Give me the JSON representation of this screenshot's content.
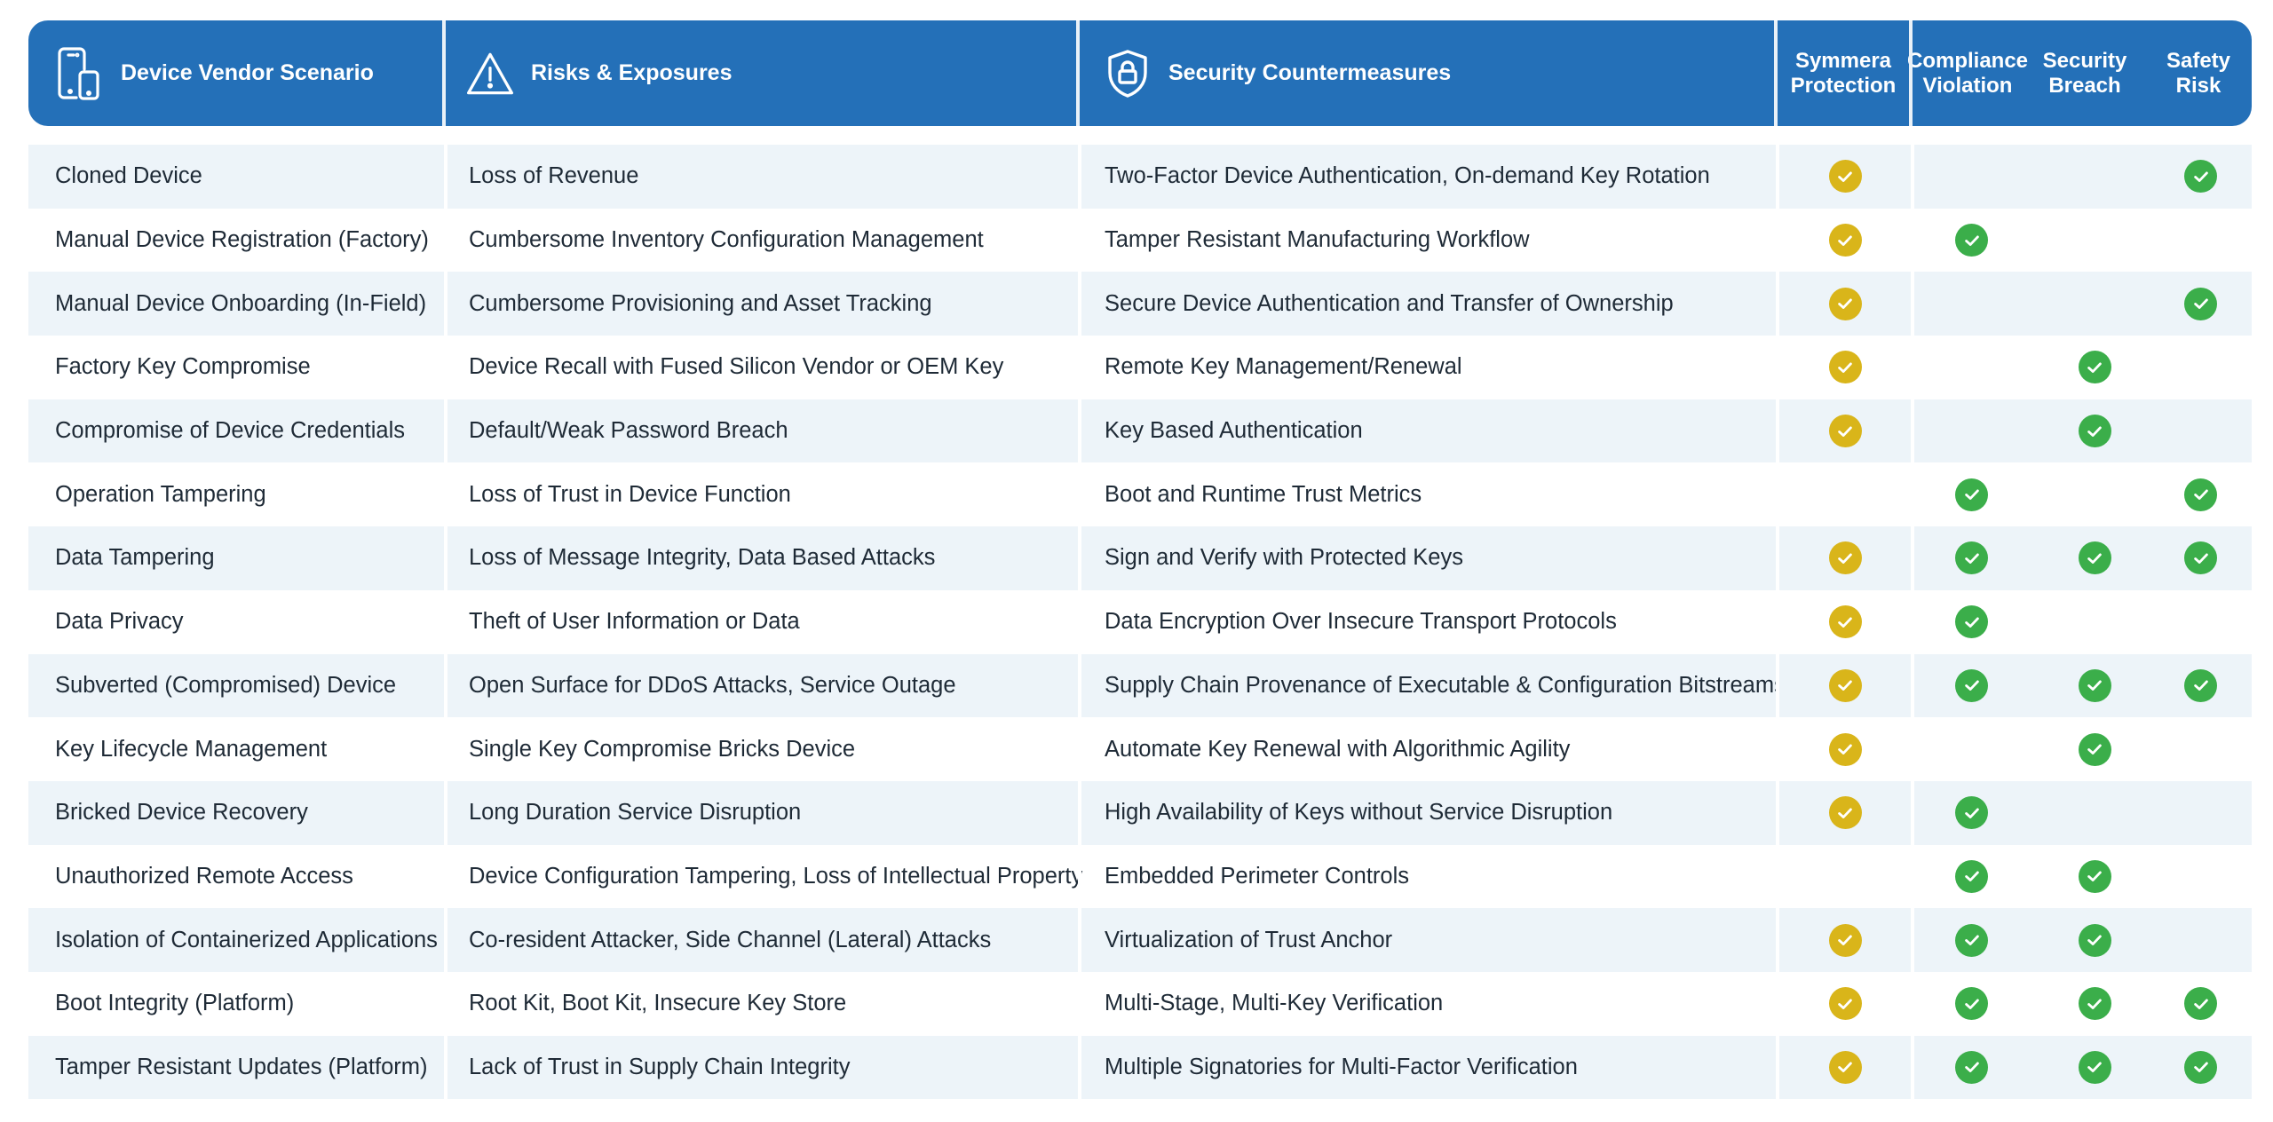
{
  "colors": {
    "header_bg": "#2470b8",
    "row_stripe": "#edf4f9",
    "symmera_check": "#d9b51a",
    "risk_check": "#3bae4a",
    "text": "#1e2a36"
  },
  "header": {
    "scenario": {
      "label": "Device Vendor Scenario",
      "icon": "mobile-devices-icon"
    },
    "risks": {
      "label": "Risks & Exposures",
      "icon": "warning-triangle-icon"
    },
    "countermeasures": {
      "label": "Security Countermeasures",
      "icon": "shield-lock-icon"
    },
    "symmera": {
      "line1": "Symmera",
      "line2": "Protection"
    },
    "compliance": {
      "line1": "Compliance",
      "line2": "Violation"
    },
    "breach": {
      "line1": "Security",
      "line2": "Breach"
    },
    "safety": {
      "line1": "Safety",
      "line2": "Risk"
    }
  },
  "rows": [
    {
      "scenario": "Cloned Device",
      "risk": "Loss of Revenue",
      "countermeasure": "Two-Factor Device Authentication, On-demand Key Rotation",
      "symmera": true,
      "compliance": false,
      "breach": false,
      "safety": true
    },
    {
      "scenario": "Manual Device Registration (Factory)",
      "risk": "Cumbersome Inventory Configuration Management",
      "countermeasure": "Tamper Resistant Manufacturing Workflow",
      "symmera": true,
      "compliance": true,
      "breach": false,
      "safety": false
    },
    {
      "scenario": "Manual Device Onboarding (In-Field)",
      "risk": "Cumbersome Provisioning and Asset Tracking",
      "countermeasure": "Secure Device Authentication and Transfer of Ownership",
      "symmera": true,
      "compliance": false,
      "breach": false,
      "safety": true
    },
    {
      "scenario": "Factory Key Compromise",
      "risk": "Device Recall with Fused Silicon Vendor or OEM Key",
      "countermeasure": "Remote Key Management/Renewal",
      "symmera": true,
      "compliance": false,
      "breach": true,
      "safety": false
    },
    {
      "scenario": "Compromise of Device Credentials",
      "risk": "Default/Weak Password Breach",
      "countermeasure": "Key Based Authentication",
      "symmera": true,
      "compliance": false,
      "breach": true,
      "safety": false
    },
    {
      "scenario": "Operation Tampering",
      "risk": "Loss of Trust in Device Function",
      "countermeasure": "Boot and Runtime Trust Metrics",
      "symmera": false,
      "compliance": true,
      "breach": false,
      "safety": true
    },
    {
      "scenario": "Data Tampering",
      "risk": "Loss of Message Integrity, Data Based Attacks",
      "countermeasure": "Sign and Verify with Protected Keys",
      "symmera": true,
      "compliance": true,
      "breach": true,
      "safety": true
    },
    {
      "scenario": "Data Privacy",
      "risk": "Theft of User Information or Data",
      "countermeasure": "Data Encryption Over Insecure Transport Protocols",
      "symmera": true,
      "compliance": true,
      "breach": false,
      "safety": false
    },
    {
      "scenario": "Subverted (Compromised) Device",
      "risk": "Open Surface for DDoS Attacks, Service Outage",
      "countermeasure": "Supply Chain Provenance of Executable & Configuration Bitstreams",
      "symmera": true,
      "compliance": true,
      "breach": true,
      "safety": true
    },
    {
      "scenario": "Key Lifecycle Management",
      "risk": "Single Key Compromise Bricks Device",
      "countermeasure": "Automate Key Renewal with Algorithmic Agility",
      "symmera": true,
      "compliance": false,
      "breach": true,
      "safety": false
    },
    {
      "scenario": "Bricked Device Recovery",
      "risk": "Long Duration Service Disruption",
      "countermeasure": "High Availability of Keys without Service Disruption",
      "symmera": true,
      "compliance": true,
      "breach": false,
      "safety": false
    },
    {
      "scenario": "Unauthorized Remote Access",
      "risk": "Device Configuration Tampering, Loss of Intellectual Property",
      "countermeasure": "Embedded Perimeter Controls",
      "symmera": false,
      "compliance": true,
      "breach": true,
      "safety": false
    },
    {
      "scenario": "Isolation of Containerized Applications",
      "risk": "Co-resident Attacker, Side Channel (Lateral) Attacks",
      "countermeasure": "Virtualization of Trust Anchor",
      "symmera": true,
      "compliance": true,
      "breach": true,
      "safety": false
    },
    {
      "scenario": "Boot Integrity (Platform)",
      "risk": "Root Kit, Boot Kit, Insecure Key Store",
      "countermeasure": "Multi-Stage, Multi-Key Verification",
      "symmera": true,
      "compliance": true,
      "breach": true,
      "safety": true
    },
    {
      "scenario": "Tamper Resistant Updates (Platform)",
      "risk": "Lack of Trust in Supply Chain Integrity",
      "countermeasure": "Multiple Signatories for Multi-Factor Verification",
      "symmera": true,
      "compliance": true,
      "breach": true,
      "safety": true
    }
  ]
}
